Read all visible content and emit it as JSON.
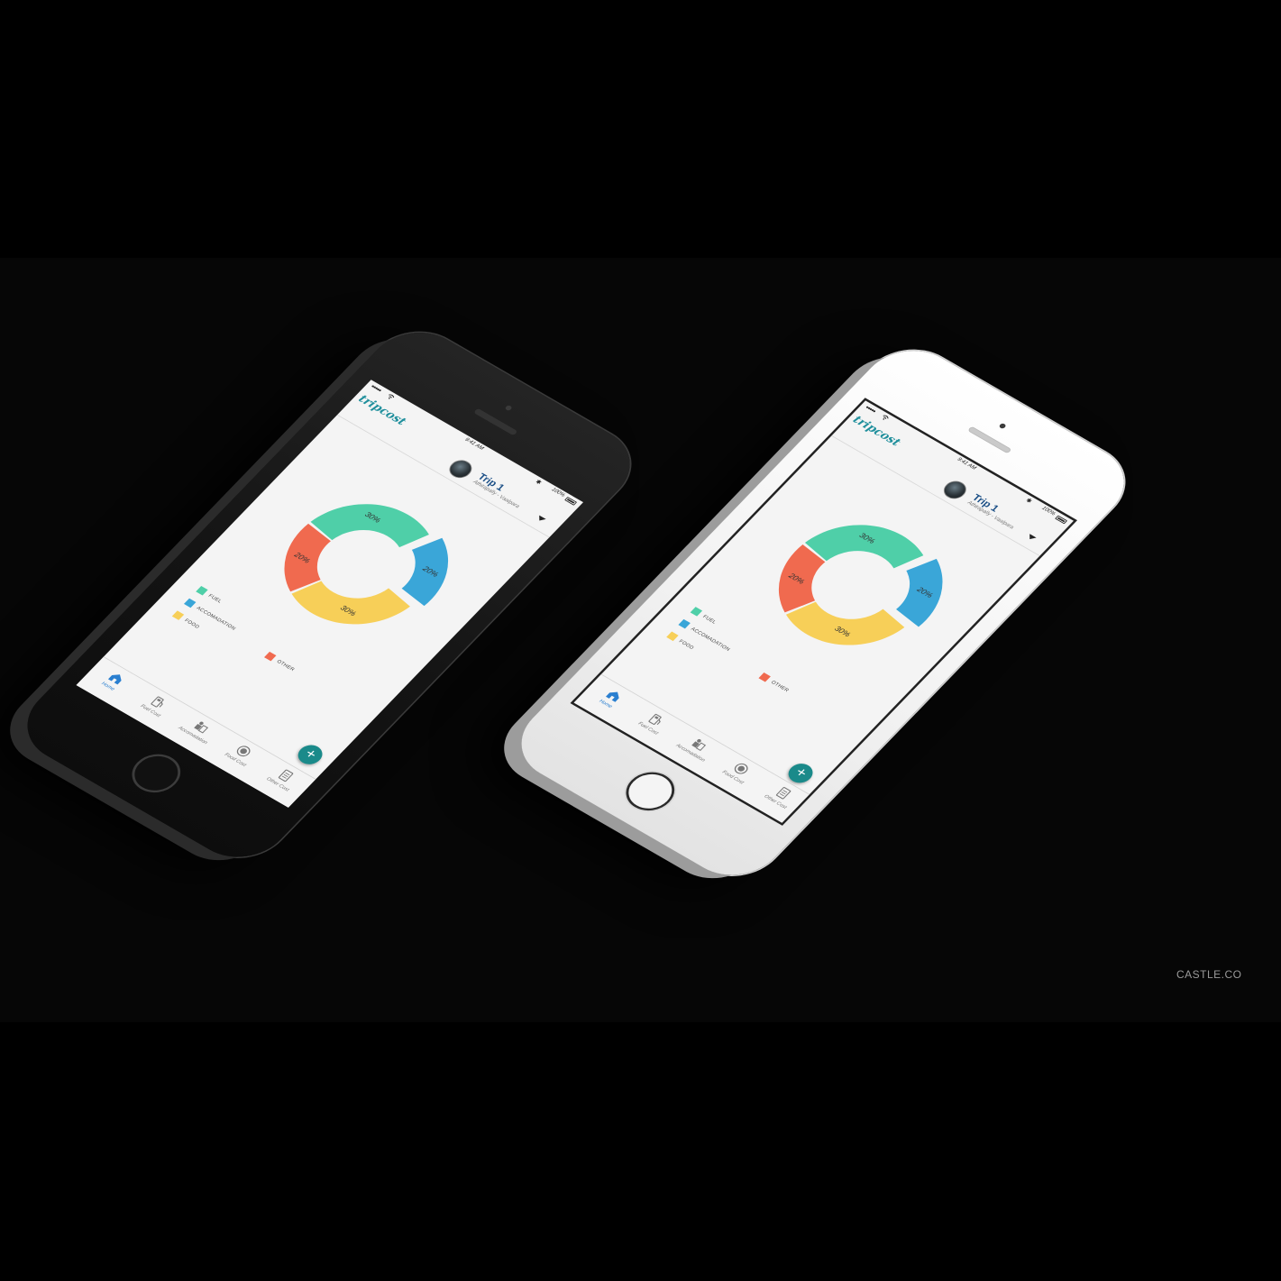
{
  "app": {
    "logo": "tripcost",
    "status": {
      "time": "9:41 AM",
      "battery": "100%"
    },
    "trip": {
      "title": "Trip 1",
      "route": "Athirapally - Vaalpara"
    },
    "tabs": [
      {
        "label": "Home",
        "icon": "home-icon",
        "active": true
      },
      {
        "label": "Fuel Cost",
        "icon": "fuel-pump-icon",
        "active": false
      },
      {
        "label": "Accomadation",
        "icon": "accommodation-icon",
        "active": false
      },
      {
        "label": "Food Cost",
        "icon": "food-icon",
        "active": false
      },
      {
        "label": "Other Cost",
        "icon": "notepad-icon",
        "active": false
      }
    ],
    "fab_icon": "plus-icon"
  },
  "chart_data": {
    "type": "pie",
    "categories": [
      "FUEL",
      "ACCOMADATION",
      "FOOD",
      "OTHER"
    ],
    "values": [
      30,
      20,
      30,
      20
    ],
    "value_labels": [
      "30%",
      "20%",
      "30%",
      "20%"
    ],
    "colors": [
      "#4fcfa8",
      "#3aa6d8",
      "#f7cf58",
      "#f06a4f"
    ]
  },
  "phones": [
    {
      "variant": "dark",
      "body_color": "#1a1a1a"
    },
    {
      "variant": "light",
      "body_color": "#f2f2f2"
    }
  ],
  "watermark": "CASTLE.CO"
}
